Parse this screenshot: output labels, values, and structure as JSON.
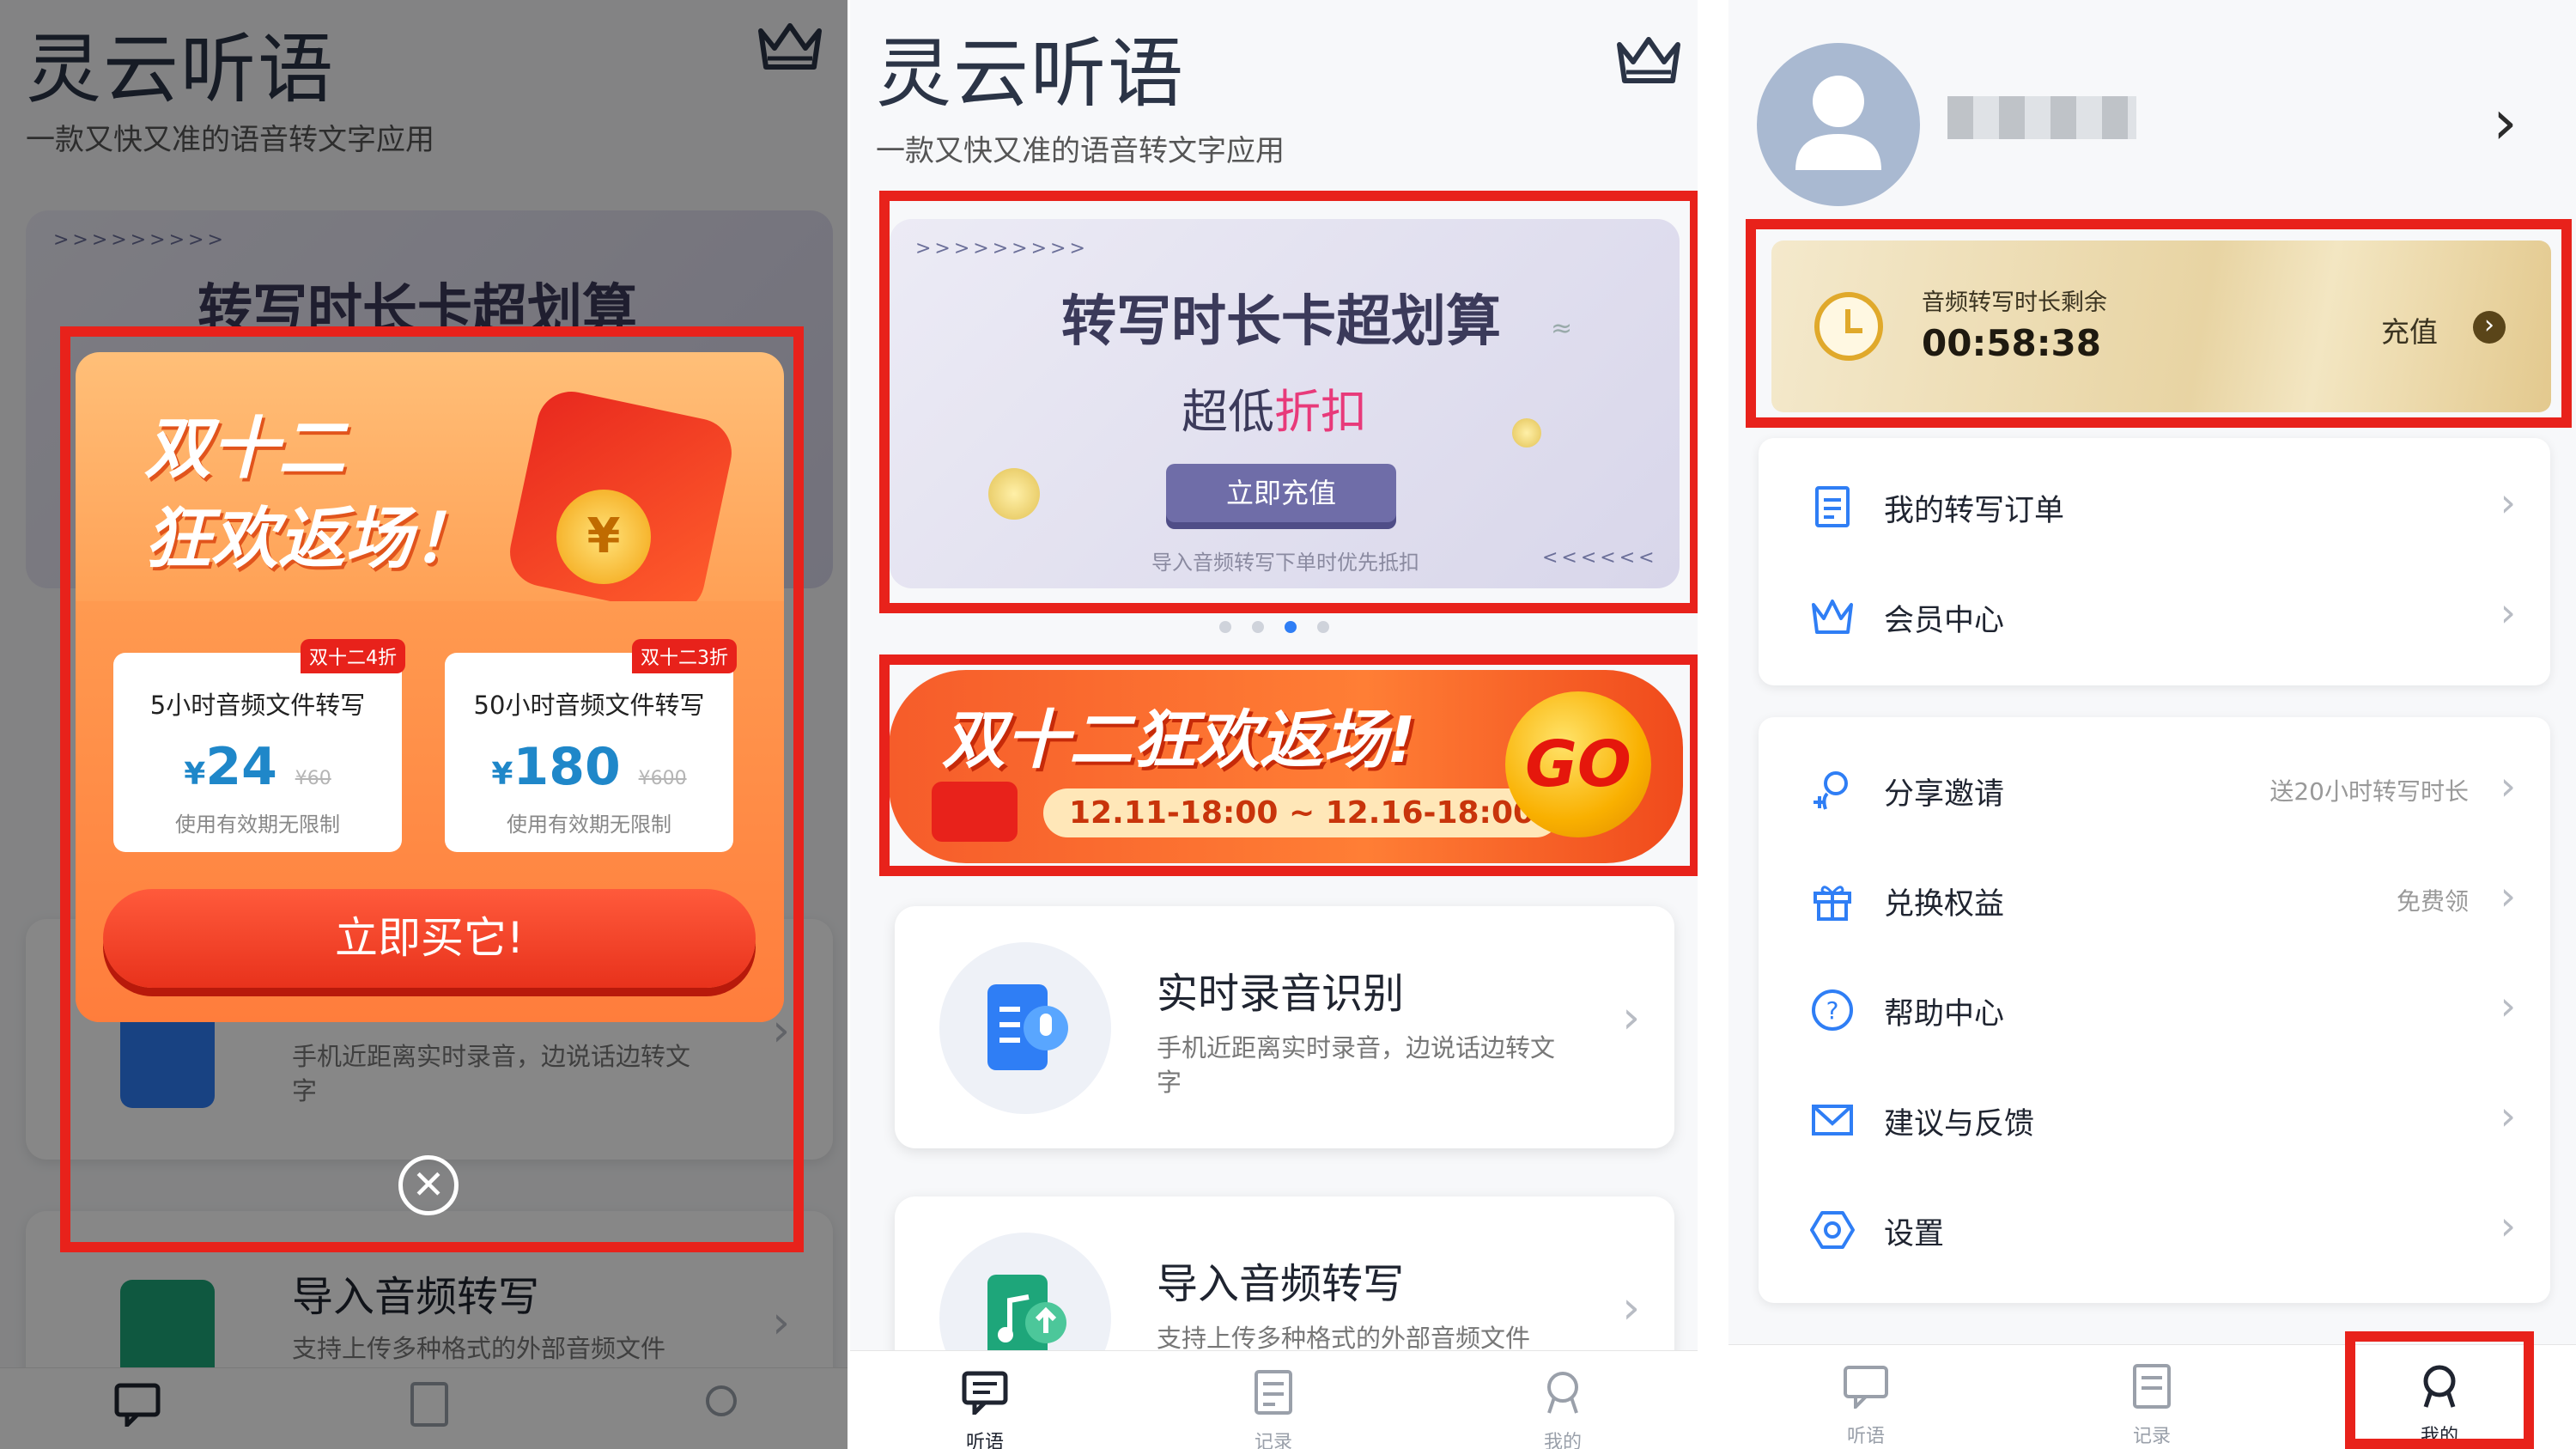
{
  "app": {
    "title": "灵云听语",
    "subtitle": "一款又快又准的语音转文字应用"
  },
  "banner": {
    "title": "转写时长卡超划算",
    "subtitle_plain": "超低",
    "subtitle_accent": "折扣",
    "button": "立即充值",
    "note": "导入音频转写下单时优先抵扣",
    "arrows_left": ">>>>>>>>>",
    "arrows_right": "<<<<<<"
  },
  "carousel": {
    "count": 4,
    "active_index": 2
  },
  "promo_banner": {
    "title": "双十二狂欢返场!",
    "dates": "12.11-18:00 ~ 12.16-18:00",
    "go": "GO"
  },
  "features": [
    {
      "title": "实时录音识别",
      "desc": "手机近距离实时录音，边说话边转文字",
      "icon": "microphone-doc-icon"
    },
    {
      "title": "导入音频转写",
      "desc": "支持上传多种格式的外部音频文件",
      "icon": "music-upload-icon"
    }
  ],
  "popup": {
    "title_line1": "双十二",
    "title_line2": "狂欢返场！",
    "options": [
      {
        "badge": "双十二4折",
        "name": "5小时音频文件转写",
        "currency": "¥",
        "price": "24",
        "orig": "¥60",
        "note": "使用有效期无限制"
      },
      {
        "badge": "双十二3折",
        "name": "50小时音频文件转写",
        "currency": "¥",
        "price": "180",
        "orig": "¥600",
        "note": "使用有效期无限制"
      }
    ],
    "buy_label": "立即买它!",
    "close_symbol": "✕"
  },
  "tabs": [
    {
      "label": "听语",
      "icon": "chat-icon"
    },
    {
      "label": "记录",
      "icon": "record-icon"
    },
    {
      "label": "我的",
      "icon": "profile-icon"
    }
  ],
  "profile": {
    "chevron": "›",
    "balance_label": "音频转写时长剩余",
    "balance_value": "00:58:38",
    "recharge": "充值",
    "recharge_arrow": "›",
    "group1": [
      {
        "label": "我的转写订单",
        "hint": "",
        "icon": "order-icon"
      },
      {
        "label": "会员中心",
        "hint": "",
        "icon": "crown-icon"
      }
    ],
    "group2": [
      {
        "label": "分享邀请",
        "hint": "送20小时转写时长",
        "icon": "share-user-icon"
      },
      {
        "label": "兑换权益",
        "hint": "免费领",
        "icon": "gift-icon"
      },
      {
        "label": "帮助中心",
        "hint": "",
        "icon": "help-icon"
      },
      {
        "label": "建议与反馈",
        "hint": "",
        "icon": "mail-icon"
      },
      {
        "label": "设置",
        "hint": "",
        "icon": "settings-icon"
      }
    ]
  },
  "colors": {
    "accent": "#2f7ef5",
    "highlight": "#e8221b",
    "promo": "#f65c2a",
    "gold": "#e8b84a"
  }
}
